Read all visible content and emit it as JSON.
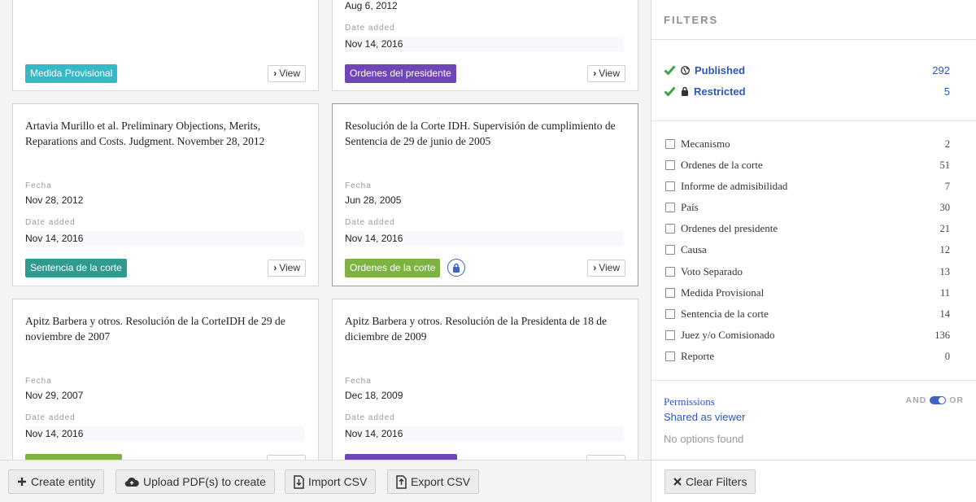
{
  "cards": [
    {
      "title": "",
      "fecha_label": "",
      "fecha": "",
      "date_added_label": "",
      "date_added": "",
      "tag": "Medida Provisional",
      "tag_color": "#36b9c7",
      "view_label": "View"
    },
    {
      "title": "",
      "fecha_label": "",
      "fecha": "Aug 6, 2012",
      "date_added_label": "Date added",
      "date_added": "Nov 14, 2016",
      "tag": "Ordenes del presidente",
      "tag_color": "#6f45b8",
      "view_label": "View"
    },
    {
      "title": "Artavia Murillo et al. Preliminary Objections, Merits, Reparations and Costs. Judgment. November 28, 2012",
      "fecha_label": "Fecha",
      "fecha": "Nov 28, 2012",
      "date_added_label": "Date added",
      "date_added": "Nov 14, 2016",
      "tag": "Sentencia de la corte",
      "tag_color": "#2f9a8d",
      "view_label": "View"
    },
    {
      "title": "Resolución de la Corte IDH. Supervisión de cumplimiento de Sentencia de 29 de junio de 2005",
      "fecha_label": "Fecha",
      "fecha": "Jun 28, 2005",
      "date_added_label": "Date added",
      "date_added": "Nov 14, 2016",
      "tag": "Ordenes de la corte",
      "tag_color": "#7cb342",
      "view_label": "View",
      "restricted_icon": "lock-icon"
    },
    {
      "title": "Apitz Barbera y otros. Resolución de la CorteIDH de 29 de noviembre de 2007",
      "fecha_label": "Fecha",
      "fecha": "Nov 29, 2007",
      "date_added_label": "Date added",
      "date_added": "Nov 14, 2016",
      "tag": "",
      "tag_color": "#7cb342",
      "view_label": ""
    },
    {
      "title": "Apitz Barbera y otros. Resolución de la Presidenta de 18 de diciembre de 2009",
      "fecha_label": "Fecha",
      "fecha": "Dec 18, 2009",
      "date_added_label": "Date added",
      "date_added": "Nov 14, 2016",
      "tag": "",
      "tag_color": "#6f45b8",
      "view_label": ""
    }
  ],
  "bottom_bar": {
    "create_entity": "Create entity",
    "upload_pdf": "Upload PDF(s) to create",
    "import_csv": "Import CSV",
    "export_csv": "Export CSV"
  },
  "filters": {
    "title": "FILTERS",
    "published": {
      "label": "Published",
      "count": "292",
      "icon": "globe-icon"
    },
    "restricted": {
      "label": "Restricted",
      "count": "5",
      "icon": "lock-icon"
    },
    "types": [
      {
        "label": "Mecanismo",
        "count": "2"
      },
      {
        "label": "Ordenes de la corte",
        "count": "51"
      },
      {
        "label": "Informe de admisibilidad",
        "count": "7"
      },
      {
        "label": "País",
        "count": "30"
      },
      {
        "label": "Ordenes del presidente",
        "count": "21"
      },
      {
        "label": "Causa",
        "count": "12"
      },
      {
        "label": "Voto Separado",
        "count": "13"
      },
      {
        "label": "Medida Provisional",
        "count": "11"
      },
      {
        "label": "Sentencia de la corte",
        "count": "14"
      },
      {
        "label": "Juez y/o Comisionado",
        "count": "136"
      },
      {
        "label": "Reporte",
        "count": "0"
      }
    ],
    "permissions": {
      "title": "Permissions",
      "and_label": "AND",
      "or_label": "OR",
      "shared": "Shared as viewer",
      "no_options": "No options found"
    },
    "clear_filters": "Clear Filters"
  },
  "colors": {
    "accent": "#2e56b8",
    "check": "#3aa54a"
  }
}
